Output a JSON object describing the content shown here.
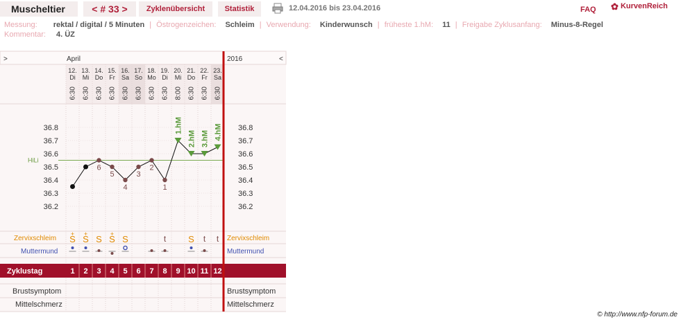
{
  "header": {
    "title": "Muscheltier",
    "cycle_number": "< # 33 >",
    "tab_overview": "Zyklenübersicht",
    "tab_stats": "Statistik",
    "date_range": "12.04.2016 bis 23.04.2016",
    "faq": "FAQ",
    "logo": "KurvenReich"
  },
  "info": {
    "messung_label": "Messung:",
    "messung_value": "rektal / digital / 5 Minuten",
    "oestrogen_label": "Östrogenzeichen:",
    "oestrogen_value": "Schleim",
    "verwendung_label": "Verwendung:",
    "verwendung_value": "Kinderwunsch",
    "hm_label": "früheste 1.hM:",
    "hm_value": "11",
    "freigabe_label": "Freigabe Zyklusanfang:",
    "freigabe_value": "Minus-8-Regel",
    "kommentar_label": "Kommentar:",
    "kommentar_value": "4. ÜZ"
  },
  "chart_data": {
    "type": "line",
    "month": "April",
    "year": "2016",
    "nav_left": ">",
    "nav_right": "<",
    "dates": [
      "12.",
      "13.",
      "14.",
      "15.",
      "16.",
      "17.",
      "18.",
      "19.",
      "20.",
      "21.",
      "22.",
      "23."
    ],
    "weekdays": [
      "Di",
      "Mi",
      "Do",
      "Fr",
      "Sa",
      "So",
      "Mo",
      "Di",
      "Mi",
      "Do",
      "Fr",
      "Sa"
    ],
    "weekend": [
      false,
      false,
      false,
      false,
      true,
      true,
      false,
      false,
      false,
      false,
      false,
      true
    ],
    "times": [
      "6:30",
      "6:30",
      "6:30",
      "6:30",
      "6:30",
      "6:30",
      "6:30",
      "6:30",
      "8:00",
      "6:30",
      "6:30",
      "6:30"
    ],
    "temperatures": [
      36.35,
      36.5,
      36.55,
      36.5,
      36.4,
      36.5,
      36.55,
      36.4,
      36.7,
      36.6,
      36.6,
      36.65
    ],
    "low_numbers": [
      "",
      "",
      "6",
      "5",
      "4",
      "3",
      "2",
      "1",
      "",
      "",
      "",
      ""
    ],
    "hm_labels": [
      "",
      "",
      "",
      "",
      "",
      "",
      "",
      "",
      "1.hM",
      "2.hM",
      "3.hM",
      "4.hM"
    ],
    "y_ticks": [
      "36.8",
      "36.7",
      "36.6",
      "36.5",
      "36.4",
      "36.3",
      "36.2"
    ],
    "ylim": [
      36.2,
      36.8
    ],
    "hili_label": "HiLi",
    "hili_value": 36.55,
    "zervix_label": "Zervixschleim",
    "zervix": [
      "S+",
      "S+",
      "S",
      "S+",
      "S",
      "",
      "",
      "t",
      "",
      "S",
      "t",
      "t"
    ],
    "muttermund_label": "Muttermund",
    "muttermund": [
      "h",
      "h",
      "m",
      "l",
      "o",
      "",
      "m",
      "m",
      "",
      "h",
      "m",
      ""
    ],
    "zyklustag_label": "Zyklustag",
    "zyklustag": [
      "1",
      "2",
      "3",
      "4",
      "5",
      "6",
      "7",
      "8",
      "9",
      "10",
      "11",
      "12"
    ],
    "brust_label": "Brustsymptom",
    "mittel_label": "Mittelschmerz"
  },
  "footer": {
    "credit": "© http://www.nfp-forum.de"
  },
  "colors": {
    "accent": "#b0203a",
    "hm_green": "#5a9a3a",
    "zervix_orange": "#e08a00",
    "muttermund_blue": "#4050b0",
    "low_brown": "#7a4a4a"
  }
}
